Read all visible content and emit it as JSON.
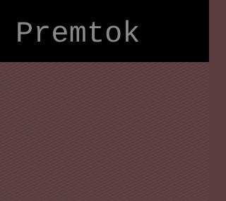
{
  "header": {
    "title": "Premtok"
  },
  "colors": {
    "header_background": "#000000",
    "title_text": "#8a8a8a",
    "content_background": "#5c3e42"
  }
}
